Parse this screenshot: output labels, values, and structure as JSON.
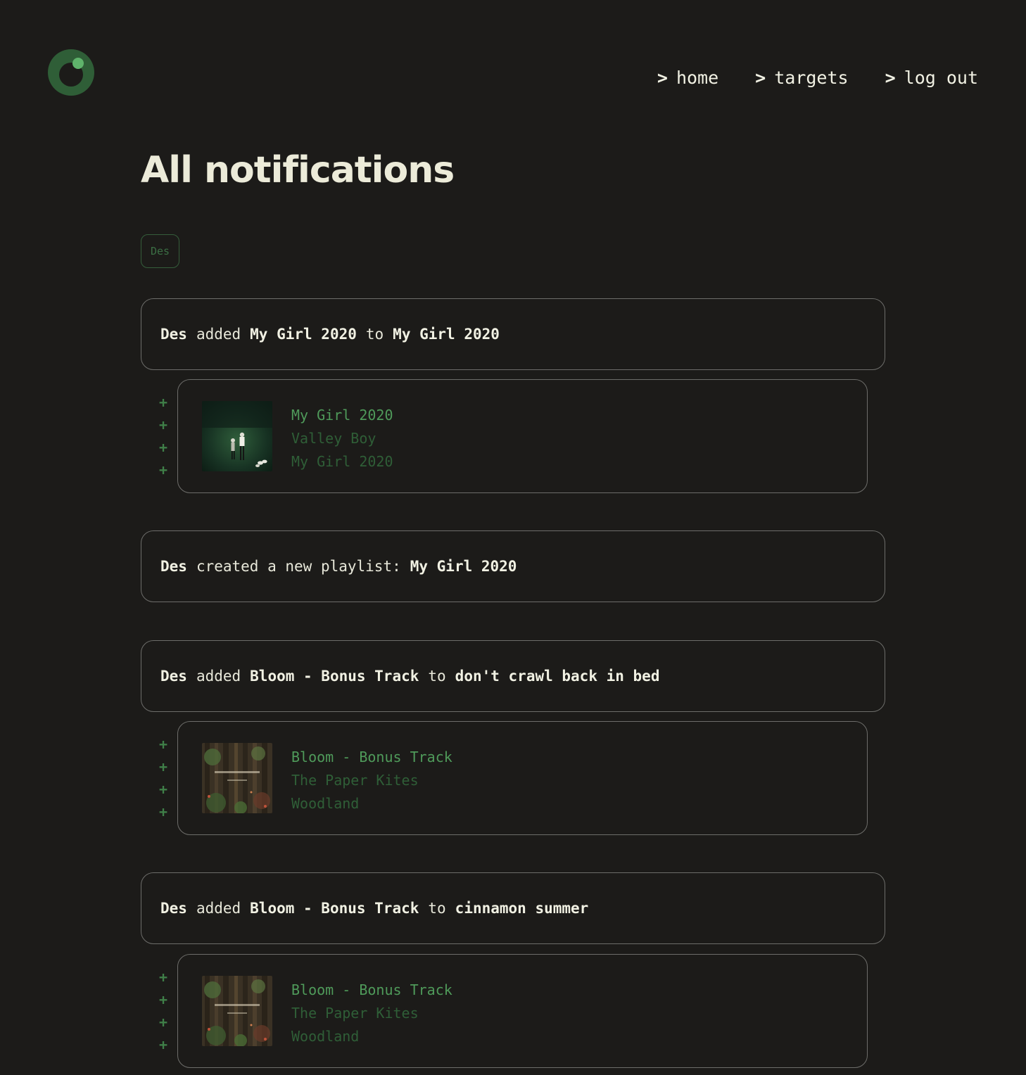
{
  "nav": {
    "items": [
      {
        "caret": ">",
        "label": "home"
      },
      {
        "caret": ">",
        "label": "targets"
      },
      {
        "caret": ">",
        "label": "log out"
      }
    ]
  },
  "page": {
    "title": "All notifications",
    "filter_chip": "Des"
  },
  "notifications": [
    {
      "user": "Des",
      "verb": "added",
      "item": "My Girl 2020",
      "connector": "to",
      "target": "My Girl 2020",
      "track": {
        "title": "My Girl 2020",
        "artist": "Valley Boy",
        "album": "My Girl 2020",
        "art_icon": "album-art-night-field"
      }
    },
    {
      "user": "Des",
      "verb": "created a new playlist:",
      "item": "My Girl 2020"
    },
    {
      "user": "Des",
      "verb": "added",
      "item": "Bloom - Bonus Track",
      "connector": "to",
      "target": "don't crawl back in bed",
      "track": {
        "title": "Bloom - Bonus Track",
        "artist": "The Paper Kites",
        "album": "Woodland",
        "art_icon": "album-art-woodland"
      }
    },
    {
      "user": "Des",
      "verb": "added",
      "item": "Bloom - Bonus Track",
      "connector": "to",
      "target": "cinnamon summer",
      "track": {
        "title": "Bloom - Bonus Track",
        "artist": "The Paper Kites",
        "album": "Woodland",
        "art_icon": "album-art-woodland"
      }
    }
  ],
  "plus_symbol": "+",
  "colors": {
    "background": "#1c1b19",
    "accent_green": "#4f9a5a",
    "dim_green": "#2f5e37",
    "logo_green": "#2f5e37",
    "logo_dot": "#5fb36b",
    "border": "#6d6d6a"
  }
}
